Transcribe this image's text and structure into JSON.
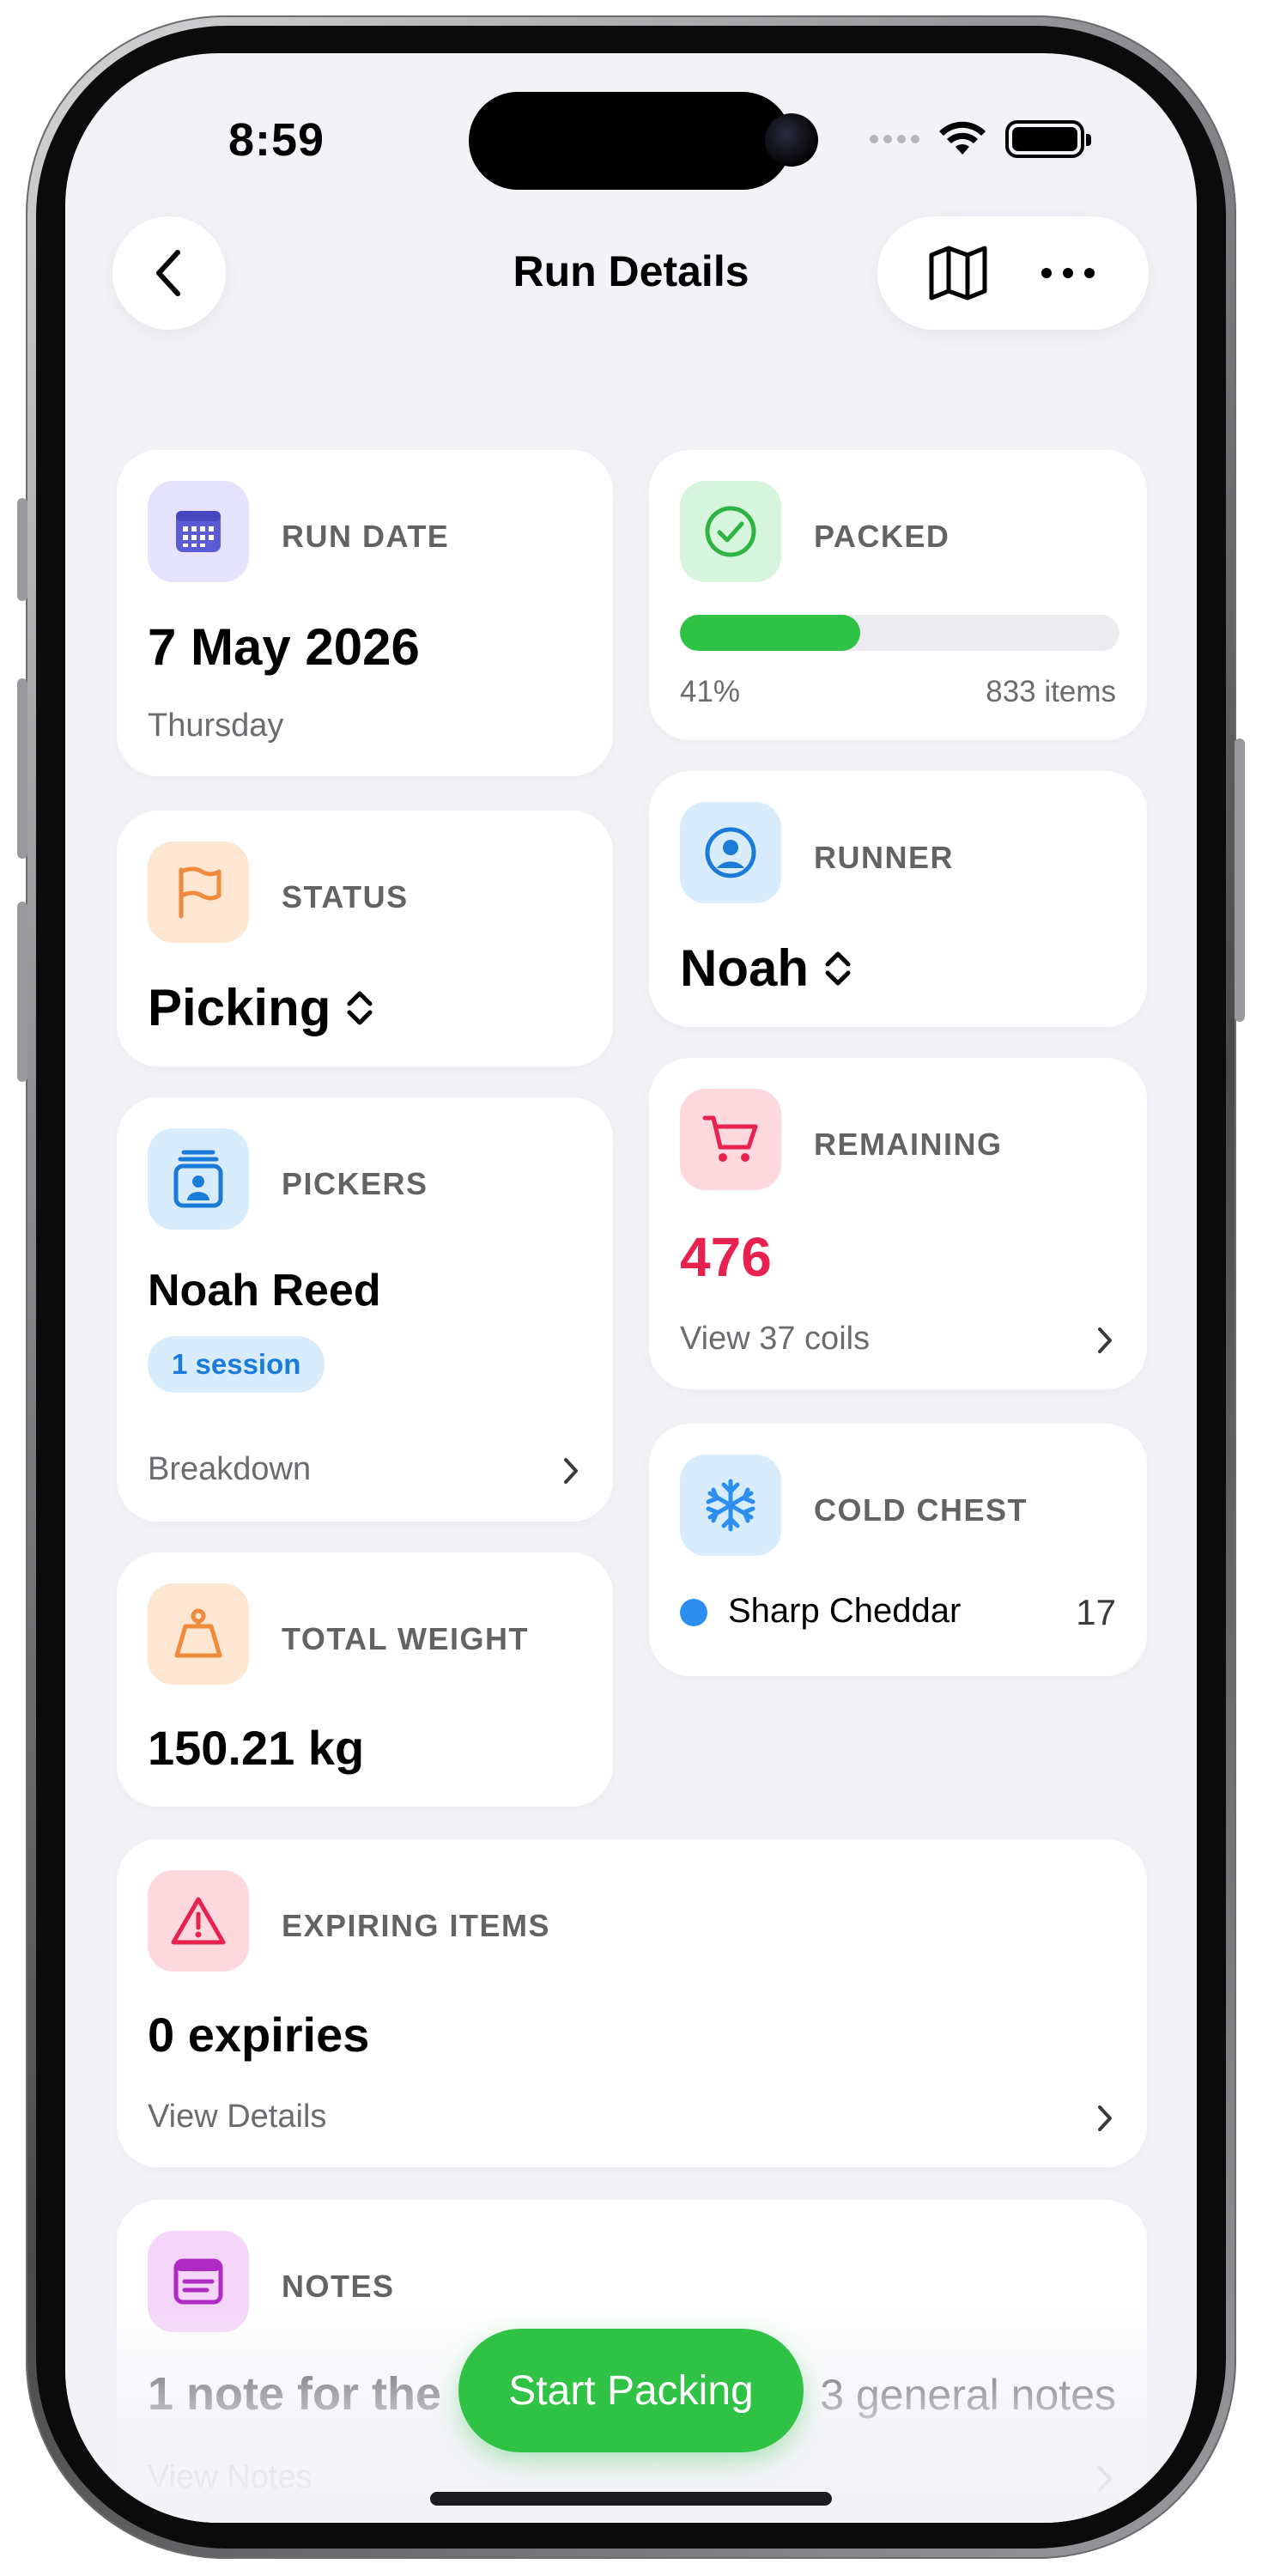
{
  "status_bar": {
    "time": "8:59"
  },
  "nav": {
    "title": "Run Details",
    "back_icon": "chevron-left-icon",
    "map_icon": "map-icon",
    "more_icon": "ellipsis-icon"
  },
  "cards": {
    "run_date": {
      "label": "RUN DATE",
      "value": "7 May 2026",
      "sub": "Thursday",
      "icon": "calendar-icon",
      "icon_color": "#5b5bd6",
      "icon_bg": "#e4e3fb"
    },
    "packed": {
      "label": "PACKED",
      "percent_text": "41%",
      "items_text": "833 items",
      "progress": 0.41,
      "icon": "checkmark-circle-icon",
      "icon_color": "#2fb344",
      "icon_bg": "#d7f4dc"
    },
    "status": {
      "label": "STATUS",
      "value": "Picking",
      "icon": "flag-icon",
      "icon_color": "#f08a3c",
      "icon_bg": "#fde6d2"
    },
    "runner": {
      "label": "RUNNER",
      "value": "Noah",
      "icon": "person-circle-icon",
      "icon_color": "#1b7bd8",
      "icon_bg": "#d8ecfb"
    },
    "pickers": {
      "label": "PICKERS",
      "value": "Noah Reed",
      "badge": "1 session",
      "sub": "Breakdown",
      "icon": "badge-person-icon",
      "icon_color": "#1b7bd8",
      "icon_bg": "#d8ecfb"
    },
    "remaining": {
      "label": "REMAINING",
      "value": "476",
      "value_color": "#e8224f",
      "sub": "View 37 coils",
      "icon": "cart-icon",
      "icon_color": "#e8224f",
      "icon_bg": "#fdd8df"
    },
    "cold_chest": {
      "label": "COLD CHEST",
      "item_name": "Sharp Cheddar",
      "item_count": "17",
      "icon": "snowflake-icon",
      "icon_color": "#2c8ff0",
      "icon_bg": "#d8ecfb"
    },
    "total_weight": {
      "label": "TOTAL WEIGHT",
      "value": "150.21 kg",
      "icon": "weight-icon",
      "icon_color": "#f08a3c",
      "icon_bg": "#fde6d2"
    },
    "expiring": {
      "label": "EXPIRING ITEMS",
      "value": "0 expiries",
      "sub": "View Details",
      "icon": "warning-triangle-icon",
      "icon_color": "#e8224f",
      "icon_bg": "#fdd8df"
    },
    "notes": {
      "label": "NOTES",
      "value_left": "1 note for the",
      "value_right": "3 general notes",
      "sub": "View Notes",
      "icon": "note-icon",
      "icon_color": "#b02ac4",
      "icon_bg": "#f4d6f8"
    }
  },
  "cta": {
    "label": "Start Packing",
    "color": "#2fc245"
  }
}
